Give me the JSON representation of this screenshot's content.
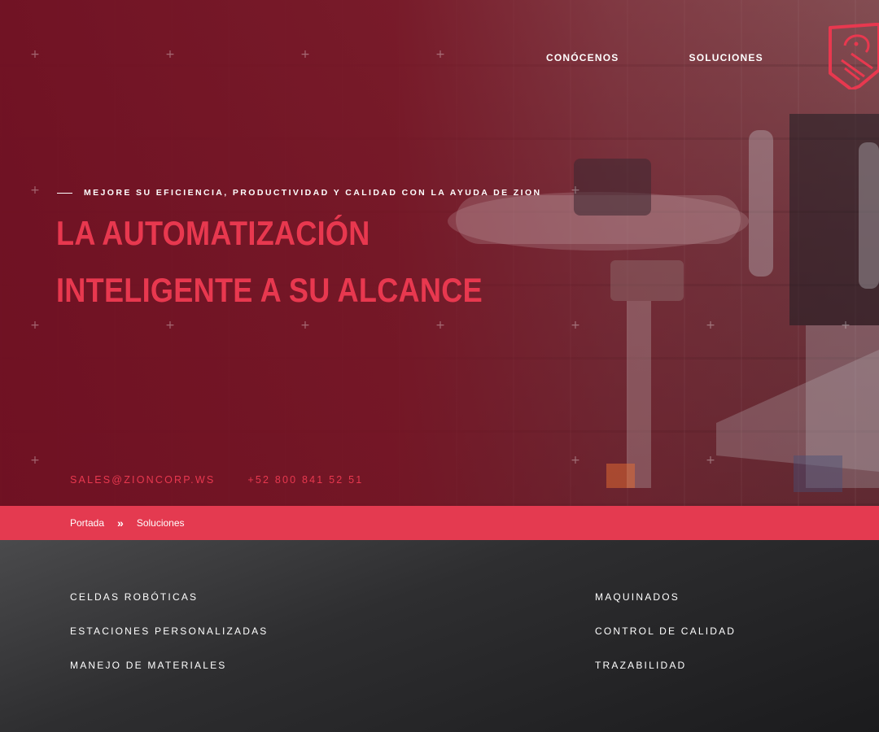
{
  "nav": {
    "items": [
      "CONÓCENOS",
      "SOLUCIONES"
    ]
  },
  "logo": {
    "icon": "lion-shield-icon",
    "color": "#e8384f"
  },
  "hero": {
    "tagline": "MEJORE SU EFICIENCIA, PRODUCTIVIDAD Y CALIDAD CON LA AYUDA DE ZION",
    "headline": "LA AUTOMATIZACIÓN INTELIGENTE A SU ALCANCE",
    "email": "SALES@ZIONCORP.WS",
    "phone": "+52 800 841 52 51"
  },
  "breadcrumb": {
    "home": "Portada",
    "separator": "»",
    "current": "Soluciones"
  },
  "solutions": {
    "left": [
      "CELDAS ROBÓTICAS",
      "ESTACIONES PERSONALIZADAS",
      "MANEJO DE MATERIALES"
    ],
    "right": [
      "MAQUINADOS",
      "CONTROL DE CALIDAD",
      "TRAZABILIDAD"
    ]
  },
  "colors": {
    "accent": "#e8384f",
    "breadcrumb_bar": "#e43a50",
    "dark": "#2a2a2c"
  }
}
